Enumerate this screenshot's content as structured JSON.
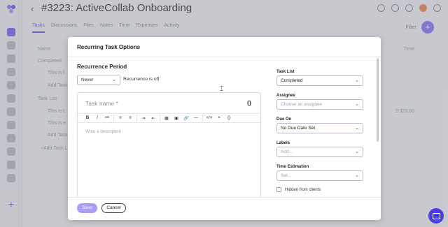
{
  "header": {
    "project_title": "#3223: ActiveCollab Onboarding",
    "tabs": [
      "Tasks",
      "Discussions",
      "Files",
      "Notes",
      "Time",
      "Expenses",
      "Activity"
    ],
    "filter_label": "Filter"
  },
  "background_list": {
    "col_name": "Name",
    "col_time": "Time",
    "completed_heading": "Completed",
    "row1": "This is f",
    "add_task_1": "Add Task",
    "task_list_heading": "Task List",
    "row2": "This is t",
    "row3": "This is e",
    "add_task_2": "Add Task",
    "add_task_list": "+Add Task Lis",
    "time_value": "2:025:00"
  },
  "modal": {
    "title": "Recurring Task Options",
    "recurrence_period_title": "Recurrence Period",
    "recurrence_select": "Never",
    "recurrence_note": "Recurrence is off",
    "task_name_placeholder": "Task name *",
    "variables_button": "{}",
    "toolbar": [
      "B",
      "I",
      "•••",
      "≡",
      "≡",
      "⇥",
      "⇤",
      "▦",
      "▣",
      "🔗",
      "—",
      "</>",
      "❝",
      "{}"
    ],
    "description_placeholder": "Write a description",
    "task_list_label": "Task List",
    "task_list_value": "Completed",
    "assignee_label": "Assignee",
    "assignee_placeholder": "Choose an assignee",
    "due_on_label": "Due On",
    "due_on_value": "No Due Date Set",
    "labels_label": "Labels",
    "labels_placeholder": "Add...",
    "time_estimation_label": "Time Estimation",
    "time_estimation_placeholder": "Set...",
    "hidden_from_clients": "Hidden from clients",
    "save_label": "Save",
    "cancel_label": "Cancel"
  },
  "colors": {
    "accent": "#7c6cf2",
    "save_button": "#a99cf7",
    "chat_button": "#4a3ee0"
  }
}
